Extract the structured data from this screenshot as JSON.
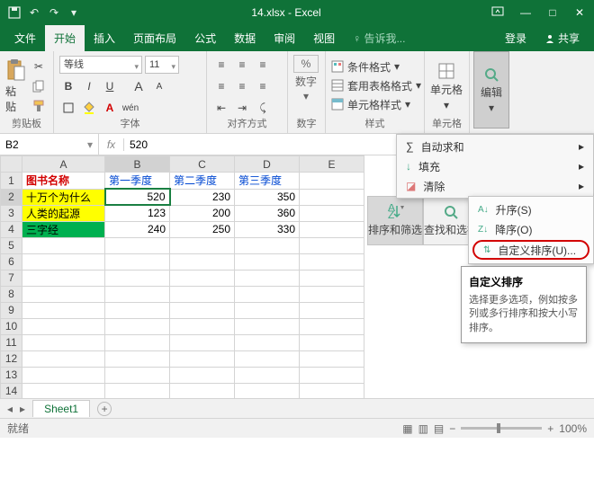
{
  "title": "14.xlsx - Excel",
  "tabs": {
    "file": "文件",
    "home": "开始",
    "insert": "插入",
    "layout": "页面布局",
    "formula": "公式",
    "data": "数据",
    "review": "审阅",
    "view": "视图",
    "tell": "告诉我...",
    "login": "登录",
    "share": "共享"
  },
  "ribbon": {
    "clipboard": {
      "label": "剪贴板",
      "paste": "粘贴"
    },
    "font": {
      "label": "字体",
      "name": "等线",
      "size": "11",
      "bold": "B",
      "italic": "I",
      "underline": "U",
      "asup": "A",
      "asub": "A",
      "wen": "wén"
    },
    "align": {
      "label": "对齐方式"
    },
    "number": {
      "label": "数字",
      "btn": "数字",
      "pct": "%"
    },
    "styles": {
      "label": "样式",
      "cond": "条件格式",
      "tbl": "套用表格格式",
      "cell": "单元格样式"
    },
    "cells": {
      "label": "单元格",
      "btn": "单元格"
    },
    "edit": {
      "label": "编辑",
      "btn": "编辑"
    }
  },
  "namebox": "B2",
  "formula": "520",
  "cols": [
    "A",
    "B",
    "C",
    "D",
    "E"
  ],
  "rows": [
    "1",
    "2",
    "3",
    "4",
    "5",
    "6",
    "7",
    "8",
    "9",
    "10",
    "11",
    "12",
    "13",
    "14"
  ],
  "data": {
    "A1": "图书名称",
    "B1": "第一季度",
    "C1": "第二季度",
    "D1": "第三季度",
    "A2": "十万个为什么",
    "B2": "520",
    "C2": "230",
    "D2": "350",
    "A3": "人类的起源",
    "B3": "123",
    "C3": "200",
    "D3": "360",
    "A4": "三字经",
    "B4": "240",
    "C4": "250",
    "D4": "330"
  },
  "editmenu": {
    "sum": "自动求和",
    "fill": "填充",
    "clear": "清除"
  },
  "bigmenus": {
    "sort": "排序和筛选",
    "find": "查找和选择"
  },
  "sortmenu": {
    "asc": "升序(S)",
    "desc": "降序(O)",
    "custom": "自定义排序(U)..."
  },
  "tooltip": {
    "title": "自定义排序",
    "body": "选择更多选项，例如按多列或多行排序和按大小写排序。"
  },
  "sheet": "Sheet1",
  "status": "就绪",
  "zoom": "100%"
}
